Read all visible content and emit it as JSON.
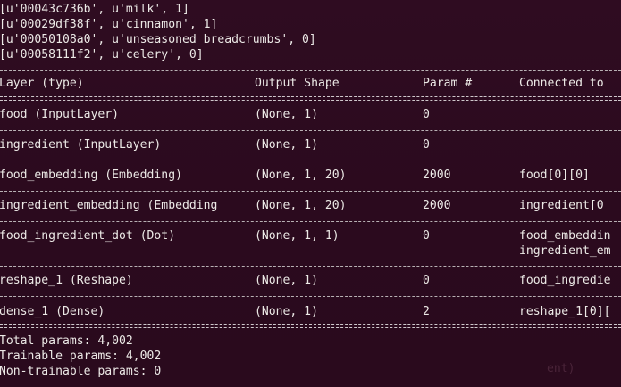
{
  "pairs": [
    "[u'00043c736b', u'milk', 1]",
    "[u'00029df38f', u'cinnamon', 1]",
    "[u'00050108a0', u'unseasoned breadcrumbs', 0]",
    "[u'00058111f2', u'celery', 0]"
  ],
  "summary": {
    "headers": {
      "layer": "Layer (type)",
      "output": "Output Shape",
      "param": "Param #",
      "connected": "Connected to"
    },
    "rows": [
      {
        "layer": "food (InputLayer)",
        "output": "(None, 1)",
        "param": "0",
        "connected": ""
      },
      {
        "layer": "ingredient (InputLayer)",
        "output": "(None, 1)",
        "param": "0",
        "connected": ""
      },
      {
        "layer": "food_embedding (Embedding)",
        "output": "(None, 1, 20)",
        "param": "2000",
        "connected": "food[0][0]"
      },
      {
        "layer": "ingredient_embedding (Embedding",
        "output": "(None, 1, 20)",
        "param": "2000",
        "connected": "ingredient[0"
      },
      {
        "layer": "food_ingredient_dot (Dot)",
        "output": "(None, 1, 1)",
        "param": "0",
        "connected": "food_embeddin",
        "connected2": "ingredient_em"
      },
      {
        "layer": "reshape_1 (Reshape)",
        "output": "(None, 1)",
        "param": "0",
        "connected": "food_ingredie"
      },
      {
        "layer": "dense_1 (Dense)",
        "output": "(None, 1)",
        "param": "2",
        "connected": "reshape_1[0]["
      }
    ],
    "totals": {
      "total": "Total params: 4,002",
      "trainable": "Trainable params: 4,002",
      "non_trainable": "Non-trainable params: 0"
    }
  }
}
